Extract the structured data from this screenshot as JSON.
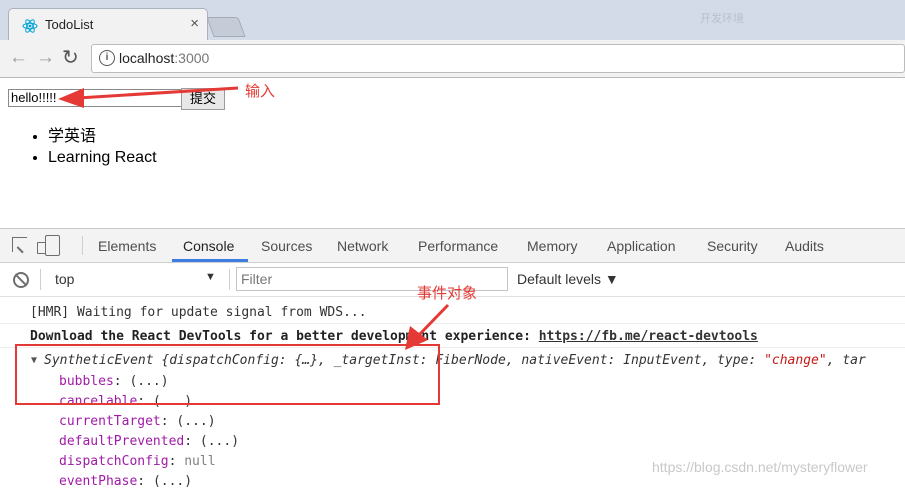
{
  "browser": {
    "tab_title": "TodoList",
    "tab_close": "×",
    "titlebar_blur": "开发环境",
    "url_host": "localhost",
    "url_port": ":3000",
    "nav": {
      "back": "←",
      "forward": "→",
      "reload": "↻"
    }
  },
  "page": {
    "input_value": "hello!!!!!",
    "submit_label": "提交",
    "todos": [
      "学英语",
      "Learning React"
    ]
  },
  "annotations": {
    "input_label": "输入",
    "event_label": "事件对象",
    "color": "#e53935"
  },
  "devtools": {
    "tabs": [
      "Elements",
      "Console",
      "Sources",
      "Network",
      "Performance",
      "Memory",
      "Application",
      "Security",
      "Audits"
    ],
    "active_tab": "Console",
    "context": "top",
    "filter_placeholder": "Filter",
    "levels": "Default levels ▼",
    "console": {
      "hmr": "[HMR] Waiting for update signal from WDS...",
      "devtools_msg": "Download the React DevTools for a better development experience: ",
      "devtools_link": "https://fb.me/react-devtools",
      "event_summary_pre": "SyntheticEvent {dispatchConfig: {…}, _targetInst: FiberNode, nativeEvent: InputEvent, type: ",
      "event_summary_type": "\"change\"",
      "event_summary_post": ", tar",
      "props": [
        {
          "name": "bubbles",
          "value": "(...)"
        },
        {
          "name": "cancelable",
          "value": "(...)"
        },
        {
          "name": "currentTarget",
          "value": "(...)"
        },
        {
          "name": "defaultPrevented",
          "value": "(...)"
        },
        {
          "name": "dispatchConfig",
          "value": "null"
        },
        {
          "name": "eventPhase",
          "value": "(...)"
        }
      ]
    }
  },
  "watermark": "https://blog.csdn.net/mysteryflower"
}
